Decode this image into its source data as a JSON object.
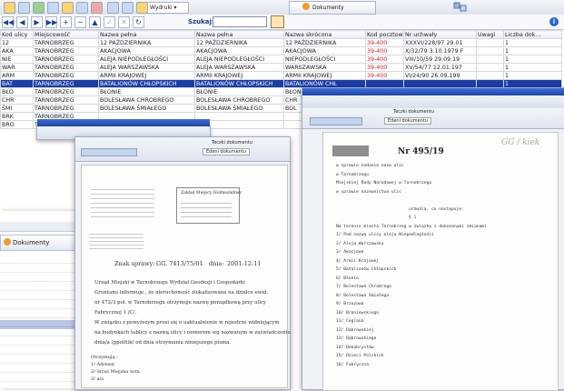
{
  "toolbar": {
    "print_menu_label": "Wydruki",
    "documents_tab_label": "Dokumenty",
    "nav_buttons": [
      "◀◀",
      "◀",
      "▶",
      "▶▶",
      "+",
      "−",
      "▲",
      "✓",
      "✕",
      "↻"
    ],
    "search_label": "Szukaj:",
    "search_value": "",
    "info_icon": "i"
  },
  "table": {
    "columns": [
      "Kod ulicy",
      "Miejscowość",
      "Nazwa pełna",
      "Nazwa pełna",
      "Nazwa skrócona",
      "Kod pocztowy",
      "Nr uchwały",
      "Uwagi",
      "Liczba dok..."
    ],
    "rows": [
      [
        "12",
        "TARNOBRZEG",
        "12 PAŹDZIERNIKA",
        "12 PAŹDZIERNIKA",
        "12 PAŹDZIERNIKA",
        "39-400",
        "XXXVI/228/97 29.01",
        "",
        "1"
      ],
      [
        "AKA",
        "TARNOBRZEG",
        "AKACJOWA",
        "AKACJOWA",
        "AKACJOWA",
        "39-400",
        "X/32/79 3.10.1979 F",
        "",
        "1"
      ],
      [
        "NIE",
        "TARNOBRZEG",
        "ALEJA NIEPODLEGŁOŚCI",
        "ALEJA NIEPODLEGŁOŚCI",
        "NIEPODLEGŁOŚCI",
        "39-400",
        "VIII/10/59 29.09.19",
        "",
        "1"
      ],
      [
        "WAR",
        "TARNOBRZEG",
        "ALEJA WARSZAWSKA",
        "ALEJA WARSZAWSKA",
        "WARSZAWSKA",
        "39-400",
        "XV/54/77 12.01.197",
        "",
        "1"
      ],
      [
        "ARM",
        "TARNOBRZEG",
        "ARMII KRAJOWEJ",
        "ARMII KRAJOWEJ",
        "ARMII KRAJOWEJ",
        "39-400",
        "VI/24/90 26.09.199",
        "",
        "1"
      ],
      [
        "BAT",
        "TARNOBRZEG",
        "BATALIONÓW CHŁOPSKICH",
        "BATALIONÓW CHŁOPSKICH",
        "BATALIONÓW CHŁ",
        "",
        "",
        "",
        "1"
      ],
      [
        "BŁO",
        "TARNOBRZEG",
        "BŁONIE",
        "BŁONIE",
        "BŁONIE",
        "",
        "",
        "",
        ""
      ],
      [
        "CHR",
        "TARNOBRZEG",
        "BOLESŁAWA CHROBREGO",
        "BOLESŁAWA CHROBREGO",
        "CHR",
        "",
        "",
        "",
        ""
      ],
      [
        "ŚMI",
        "TARNOBRZEG",
        "BOLESŁAWA ŚMIAŁEGO",
        "BOLESŁAWA ŚMIAŁEGO",
        "BOL",
        "",
        "",
        "",
        ""
      ],
      [
        "BRK",
        "TARNOBRZEG",
        "",
        "",
        "",
        "",
        "",
        "",
        ""
      ],
      [
        "BRO",
        "TARNOBRZEG",
        "",
        "",
        "",
        "",
        "",
        "",
        ""
      ]
    ],
    "selected_row": 5
  },
  "left_panel": {
    "documents_tab_label": "Dokumenty"
  },
  "doc_window": {
    "tab_label": "Teczki dokumentu",
    "tab_sub_label": "Edeni dokumentu",
    "letter": {
      "sender_name": "Zakład Miejscy Holmsondney",
      "sign_label": "Znak sprawy:",
      "sign_value": "GG. 7413/75/01",
      "date_label": "dnia:",
      "date_value": "2001-12-11",
      "body_lines": [
        "Urząd Miejski w Tarnobrzegu Wydział Geodezji i Gospodarki",
        "Gruntami informuje , że nieruchomość zlokalizowana na działce ewid.",
        "nr 472/3 poł. w Tarnobrzegu otrzymuje nazwę porządkową przy ulicy",
        "Fabrycznej 1 /C/.",
        "W związku z powyższym prosi się o uaktualnienie w rejestrze widniejącym",
        "na budynkach tablicy z nazwą ulicy i numerem wg nazwanym w zaświadczeniu",
        "dnia/a (ppolitik) od dnia otrzymania niniejszego pisma."
      ],
      "footer_lines": [
        "Otrzymują :",
        "1/ Adresat",
        "2/ Straż Miejska w/m.",
        "3/ a/a"
      ]
    }
  },
  "doc_window_right": {
    "tab_label": "Teczki dokumentu",
    "tab_sub_label": "Edeni dokumentu",
    "stamp": "GG / kiek",
    "heading": "Nr 495/19",
    "paragraph_lines": [
      "w sprawie nadania nazw ulic",
      "w Tarnobrzegu",
      "Miejskiej Rady Narodowej w Tarnobrzegu",
      "w sprawie nazewnictwa ulic",
      "",
      "uchwala, co następuje:",
      "§ 1",
      "Na terenie miasta Tarnobrzeg w związku z dokonanymi zmianami",
      "1/ Pod nazwą ulicy aleja Niepodległości",
      "2/ Aleja Warszawska",
      "3/ Akacjowa",
      "4/ Armii Krajowej",
      "5/ Batalionów Chłopskich",
      "6/ Błonie",
      "7/ Bolesława Chrobrego",
      "8/ Bolesława Śmiałego",
      "9/ Brzozowa",
      "10/ Broniewskiego",
      "11/ Ceglana",
      "12/ Dąbrowskiej",
      "13/ Dąbrowskiego",
      "14/ Dekabrystów",
      "15/ Dzieci Polskich",
      "16/ Fabryczna"
    ]
  },
  "colors": {
    "selected_row": "#1c3ea8",
    "postal_code": "#d21a1a",
    "accent": "#f39a2b"
  }
}
